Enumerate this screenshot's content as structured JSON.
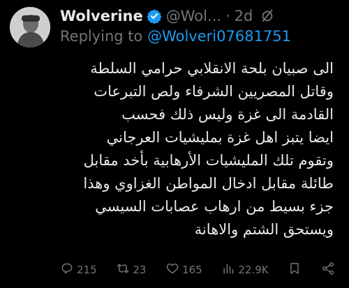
{
  "tweet": {
    "author_name": "Wolverine",
    "handle": "@Wol...",
    "separator": "·",
    "time": "2d",
    "replying_prefix": "Replying to",
    "replying_handle": "@Wolveri07681751",
    "lines": [
      "الى صبيان بلحة الانقلابي حرامي السلطة",
      "وقاتل المصريين الشرفاء ولص التبرعات",
      "القادمة الى غزة وليس ذلك فحسب",
      "ايضا يتبز اهل غزة بمليشيات العرجاني",
      "وتقوم تلك المليشيات الأرهابية بأخد مقابل",
      "طائلة مقابل ادخال المواطن الغزاوي  وهذا",
      "جزء بسيط من ارهاب عصابات السيسي",
      "ويستحق الشتم والاهانة"
    ]
  },
  "actions": {
    "replies": "215",
    "reposts": "23",
    "likes": "165",
    "views": "22.9K"
  },
  "colors": {
    "background": "#000000",
    "text": "#e7e9ea",
    "muted": "#71767b",
    "link": "#1d9bf0"
  },
  "icons": [
    "verified-badge-icon",
    "grok-icon",
    "reply-icon",
    "repost-icon",
    "like-icon",
    "views-icon",
    "bookmark-icon",
    "share-icon"
  ]
}
